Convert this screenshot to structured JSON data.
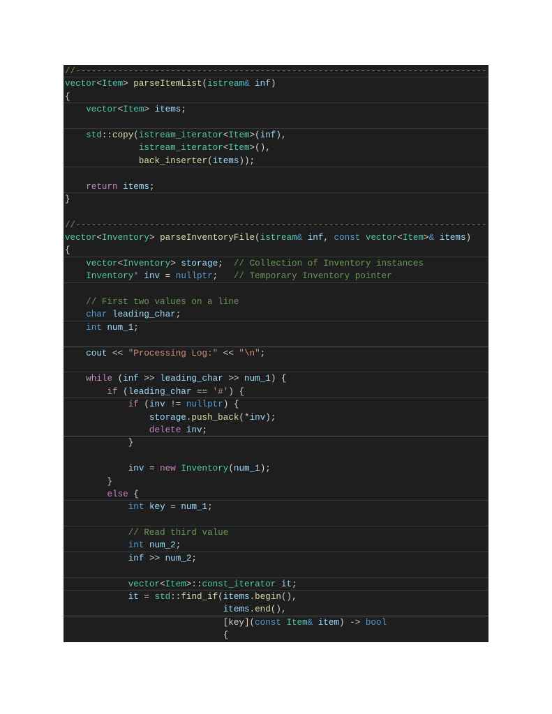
{
  "document": {
    "language": "cpp",
    "theme_colors": {
      "background": "#1e1e1e",
      "comment": "#6a9955",
      "type": "#4ec9b0",
      "function": "#dcdcaa",
      "variable": "#9cdcfe",
      "keyword": "#569cd6",
      "control": "#c586c0",
      "string": "#ce9178",
      "plain": "#d4d4d4"
    },
    "lines": [
      {
        "sep": 1,
        "tokens": [
          [
            "comment",
            "//-------------------------------------------------------------------------------"
          ]
        ]
      },
      {
        "sep": 0,
        "tokens": [
          [
            "type",
            "vector"
          ],
          [
            "op",
            "<"
          ],
          [
            "type",
            "Item"
          ],
          [
            "op",
            "> "
          ],
          [
            "func",
            "parseItemList"
          ],
          [
            "plain",
            "("
          ],
          [
            "type",
            "istream"
          ],
          [
            "kw",
            "&"
          ],
          [
            "plain",
            " "
          ],
          [
            "var",
            "inf"
          ],
          [
            "plain",
            ")"
          ]
        ]
      },
      {
        "sep": 1,
        "tokens": [
          [
            "plain",
            "{"
          ]
        ]
      },
      {
        "sep": 0,
        "tokens": [
          [
            "plain",
            "    "
          ],
          [
            "type",
            "vector"
          ],
          [
            "op",
            "<"
          ],
          [
            "type",
            "Item"
          ],
          [
            "op",
            "> "
          ],
          [
            "var",
            "items"
          ],
          [
            "plain",
            ";"
          ]
        ]
      },
      {
        "sep": 1,
        "tokens": [
          [
            "plain",
            ""
          ]
        ]
      },
      {
        "sep": 0,
        "tokens": [
          [
            "plain",
            "    "
          ],
          [
            "type",
            "std"
          ],
          [
            "plain",
            "::"
          ],
          [
            "func",
            "copy"
          ],
          [
            "plain",
            "("
          ],
          [
            "type",
            "istream_iterator"
          ],
          [
            "op",
            "<"
          ],
          [
            "type",
            "Item"
          ],
          [
            "op",
            ">"
          ],
          [
            "plain",
            "("
          ],
          [
            "var",
            "inf"
          ],
          [
            "plain",
            "),"
          ]
        ]
      },
      {
        "sep": 0,
        "tokens": [
          [
            "plain",
            "              "
          ],
          [
            "type",
            "istream_iterator"
          ],
          [
            "op",
            "<"
          ],
          [
            "type",
            "Item"
          ],
          [
            "op",
            ">"
          ],
          [
            "plain",
            "(),"
          ]
        ]
      },
      {
        "sep": 1,
        "tokens": [
          [
            "plain",
            "              "
          ],
          [
            "func",
            "back_inserter"
          ],
          [
            "plain",
            "("
          ],
          [
            "var",
            "items"
          ],
          [
            "plain",
            "));"
          ]
        ]
      },
      {
        "sep": 0,
        "tokens": [
          [
            "plain",
            ""
          ]
        ]
      },
      {
        "sep": 1,
        "tokens": [
          [
            "plain",
            "    "
          ],
          [
            "ctrl",
            "return"
          ],
          [
            "plain",
            " "
          ],
          [
            "var",
            "items"
          ],
          [
            "plain",
            ";"
          ]
        ]
      },
      {
        "sep": 0,
        "tokens": [
          [
            "plain",
            "}"
          ]
        ]
      },
      {
        "sep": 0,
        "tokens": [
          [
            "plain",
            ""
          ]
        ]
      },
      {
        "sep": 0,
        "tokens": [
          [
            "comment",
            "//-------------------------------------------------------------------------------"
          ]
        ]
      },
      {
        "sep": 0,
        "tokens": [
          [
            "type",
            "vector"
          ],
          [
            "op",
            "<"
          ],
          [
            "type",
            "Inventory"
          ],
          [
            "op",
            "> "
          ],
          [
            "func",
            "parseInventoryFile"
          ],
          [
            "plain",
            "("
          ],
          [
            "type",
            "istream"
          ],
          [
            "kw",
            "&"
          ],
          [
            "plain",
            " "
          ],
          [
            "var",
            "inf"
          ],
          [
            "plain",
            ", "
          ],
          [
            "kw",
            "const"
          ],
          [
            "plain",
            " "
          ],
          [
            "type",
            "vector"
          ],
          [
            "op",
            "<"
          ],
          [
            "type",
            "Item"
          ],
          [
            "op",
            ">"
          ],
          [
            "kw",
            "&"
          ],
          [
            "plain",
            " "
          ],
          [
            "var",
            "items"
          ],
          [
            "plain",
            ")"
          ]
        ]
      },
      {
        "sep": 1,
        "tokens": [
          [
            "plain",
            "{"
          ]
        ]
      },
      {
        "sep": 0,
        "tokens": [
          [
            "plain",
            "    "
          ],
          [
            "type",
            "vector"
          ],
          [
            "op",
            "<"
          ],
          [
            "type",
            "Inventory"
          ],
          [
            "op",
            "> "
          ],
          [
            "var",
            "storage"
          ],
          [
            "plain",
            ";  "
          ],
          [
            "comment",
            "// Collection of Inventory instances"
          ]
        ]
      },
      {
        "sep": 1,
        "tokens": [
          [
            "plain",
            "    "
          ],
          [
            "type",
            "Inventory"
          ],
          [
            "kw",
            "*"
          ],
          [
            "plain",
            " "
          ],
          [
            "var",
            "inv"
          ],
          [
            "plain",
            " = "
          ],
          [
            "kw",
            "nullptr"
          ],
          [
            "plain",
            ";   "
          ],
          [
            "comment",
            "// Temporary Inventory pointer"
          ]
        ]
      },
      {
        "sep": 0,
        "tokens": [
          [
            "plain",
            ""
          ]
        ]
      },
      {
        "sep": 0,
        "tokens": [
          [
            "plain",
            "    "
          ],
          [
            "comment",
            "// First two values on a line"
          ]
        ]
      },
      {
        "sep": 1,
        "tokens": [
          [
            "plain",
            "    "
          ],
          [
            "kw",
            "char"
          ],
          [
            "plain",
            " "
          ],
          [
            "var",
            "leading_char"
          ],
          [
            "plain",
            ";"
          ]
        ]
      },
      {
        "sep": 0,
        "tokens": [
          [
            "plain",
            "    "
          ],
          [
            "kw",
            "int"
          ],
          [
            "plain",
            " "
          ],
          [
            "var",
            "num_1"
          ],
          [
            "plain",
            ";"
          ]
        ]
      },
      {
        "sep": 2,
        "tokens": [
          [
            "plain",
            ""
          ]
        ]
      },
      {
        "sep": 0,
        "tokens": [
          [
            "plain",
            "    "
          ],
          [
            "var",
            "cout"
          ],
          [
            "plain",
            " << "
          ],
          [
            "str",
            "\"Processing Log:\""
          ],
          [
            "plain",
            " << "
          ],
          [
            "str",
            "\"\\n\""
          ],
          [
            "plain",
            ";"
          ]
        ]
      },
      {
        "sep": 1,
        "tokens": [
          [
            "plain",
            ""
          ]
        ]
      },
      {
        "sep": 0,
        "tokens": [
          [
            "plain",
            "    "
          ],
          [
            "ctrl",
            "while"
          ],
          [
            "plain",
            " ("
          ],
          [
            "var",
            "inf"
          ],
          [
            "plain",
            " >> "
          ],
          [
            "var",
            "leading_char"
          ],
          [
            "plain",
            " >> "
          ],
          [
            "var",
            "num_1"
          ],
          [
            "plain",
            ") {"
          ]
        ]
      },
      {
        "sep": 1,
        "tokens": [
          [
            "plain",
            "        "
          ],
          [
            "ctrl",
            "if"
          ],
          [
            "plain",
            " ("
          ],
          [
            "var",
            "leading_char"
          ],
          [
            "plain",
            " == "
          ],
          [
            "str",
            "'#'"
          ],
          [
            "plain",
            ") {"
          ]
        ]
      },
      {
        "sep": 0,
        "tokens": [
          [
            "plain",
            "            "
          ],
          [
            "ctrl",
            "if"
          ],
          [
            "plain",
            " ("
          ],
          [
            "var",
            "inv"
          ],
          [
            "plain",
            " != "
          ],
          [
            "kw",
            "nullptr"
          ],
          [
            "plain",
            ") {"
          ]
        ]
      },
      {
        "sep": 0,
        "tokens": [
          [
            "plain",
            "                "
          ],
          [
            "var",
            "storage"
          ],
          [
            "plain",
            "."
          ],
          [
            "func",
            "push_back"
          ],
          [
            "plain",
            "(*"
          ],
          [
            "var",
            "inv"
          ],
          [
            "plain",
            ");"
          ]
        ]
      },
      {
        "sep": 2,
        "tokens": [
          [
            "plain",
            "                "
          ],
          [
            "ctrl",
            "delete"
          ],
          [
            "plain",
            " "
          ],
          [
            "var",
            "inv"
          ],
          [
            "plain",
            ";"
          ]
        ]
      },
      {
        "sep": 0,
        "tokens": [
          [
            "plain",
            "            }"
          ]
        ]
      },
      {
        "sep": 0,
        "tokens": [
          [
            "plain",
            ""
          ]
        ]
      },
      {
        "sep": 0,
        "tokens": [
          [
            "plain",
            "            "
          ],
          [
            "var",
            "inv"
          ],
          [
            "plain",
            " = "
          ],
          [
            "ctrl",
            "new"
          ],
          [
            "plain",
            " "
          ],
          [
            "type",
            "Inventory"
          ],
          [
            "plain",
            "("
          ],
          [
            "var",
            "num_1"
          ],
          [
            "plain",
            ");"
          ]
        ]
      },
      {
        "sep": 0,
        "tokens": [
          [
            "plain",
            "        }"
          ]
        ]
      },
      {
        "sep": 1,
        "tokens": [
          [
            "plain",
            "        "
          ],
          [
            "ctrl",
            "else"
          ],
          [
            "plain",
            " {"
          ]
        ]
      },
      {
        "sep": 0,
        "tokens": [
          [
            "plain",
            "            "
          ],
          [
            "kw",
            "int"
          ],
          [
            "plain",
            " "
          ],
          [
            "var",
            "key"
          ],
          [
            "plain",
            " = "
          ],
          [
            "var",
            "num_1"
          ],
          [
            "plain",
            ";"
          ]
        ]
      },
      {
        "sep": 1,
        "tokens": [
          [
            "plain",
            ""
          ]
        ]
      },
      {
        "sep": 0,
        "tokens": [
          [
            "plain",
            "            "
          ],
          [
            "comment",
            "// Read third value"
          ]
        ]
      },
      {
        "sep": 1,
        "tokens": [
          [
            "plain",
            "            "
          ],
          [
            "kw",
            "int"
          ],
          [
            "plain",
            " "
          ],
          [
            "var",
            "num_2"
          ],
          [
            "plain",
            ";"
          ]
        ]
      },
      {
        "sep": 0,
        "tokens": [
          [
            "plain",
            "            "
          ],
          [
            "var",
            "inf"
          ],
          [
            "plain",
            " >> "
          ],
          [
            "var",
            "num_2"
          ],
          [
            "plain",
            ";"
          ]
        ]
      },
      {
        "sep": 1,
        "tokens": [
          [
            "plain",
            ""
          ]
        ]
      },
      {
        "sep": 1,
        "tokens": [
          [
            "plain",
            "            "
          ],
          [
            "type",
            "vector"
          ],
          [
            "op",
            "<"
          ],
          [
            "type",
            "Item"
          ],
          [
            "op",
            ">"
          ],
          [
            "plain",
            "::"
          ],
          [
            "type",
            "const_iterator"
          ],
          [
            "plain",
            " "
          ],
          [
            "var",
            "it"
          ],
          [
            "plain",
            ";"
          ]
        ]
      },
      {
        "sep": 0,
        "tokens": [
          [
            "plain",
            "            "
          ],
          [
            "var",
            "it"
          ],
          [
            "plain",
            " = "
          ],
          [
            "type",
            "std"
          ],
          [
            "plain",
            "::"
          ],
          [
            "func",
            "find_if"
          ],
          [
            "plain",
            "("
          ],
          [
            "var",
            "items"
          ],
          [
            "plain",
            "."
          ],
          [
            "func",
            "begin"
          ],
          [
            "plain",
            "(),"
          ]
        ]
      },
      {
        "sep": 2,
        "tokens": [
          [
            "plain",
            "                              "
          ],
          [
            "var",
            "items"
          ],
          [
            "plain",
            "."
          ],
          [
            "func",
            "end"
          ],
          [
            "plain",
            "(),"
          ]
        ]
      },
      {
        "sep": 0,
        "tokens": [
          [
            "plain",
            "                              [key]("
          ],
          [
            "kw",
            "const"
          ],
          [
            "plain",
            " "
          ],
          [
            "type",
            "Item"
          ],
          [
            "kw",
            "&"
          ],
          [
            "plain",
            " "
          ],
          [
            "var",
            "item"
          ],
          [
            "plain",
            ") -> "
          ],
          [
            "kw",
            "bool"
          ]
        ]
      },
      {
        "sep": 0,
        "tokens": [
          [
            "plain",
            "                              {"
          ]
        ]
      }
    ]
  }
}
